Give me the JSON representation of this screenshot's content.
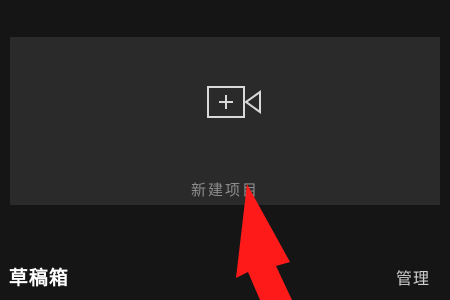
{
  "new_project": {
    "label": "新建项目",
    "icon": "video-camera-plus-icon"
  },
  "drafts": {
    "title": "草稿箱",
    "manage_label": "管理"
  },
  "annotation": {
    "arrow_color": "#ff1a1a"
  },
  "colors": {
    "background": "#151515",
    "card": "#2a2a2a",
    "icon_stroke": "#d9d9d9"
  }
}
